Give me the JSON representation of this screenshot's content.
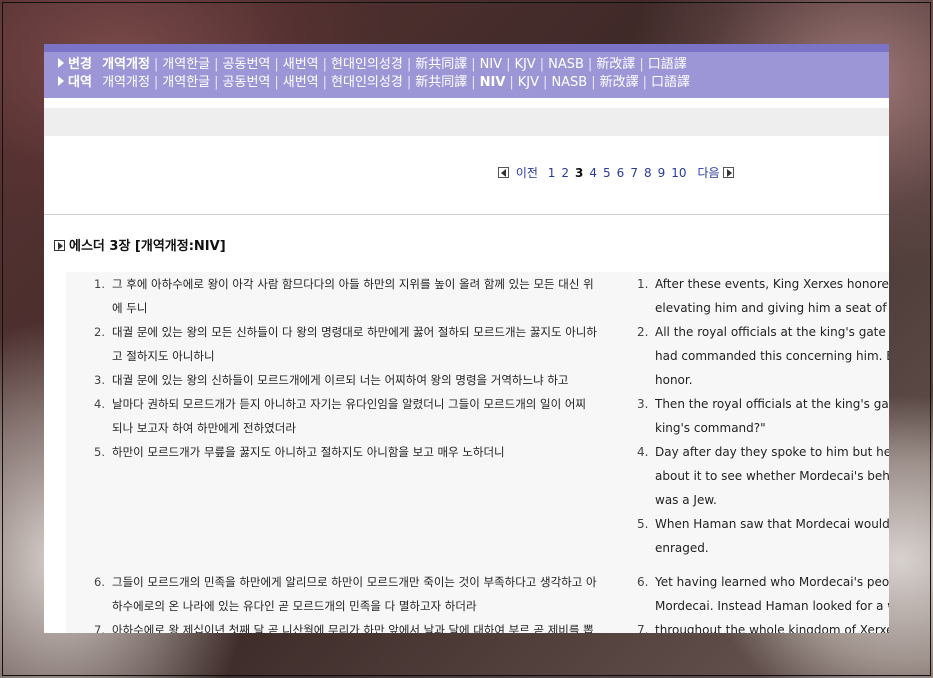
{
  "nav": {
    "row1": {
      "label": "변경",
      "items": [
        {
          "text": "개역개정",
          "bold": true
        },
        {
          "text": "개역한글"
        },
        {
          "text": "공동번역"
        },
        {
          "text": "새번역"
        },
        {
          "text": "현대인의성경"
        },
        {
          "text": "新共同譯"
        },
        {
          "text": "NIV"
        },
        {
          "text": "KJV"
        },
        {
          "text": "NASB"
        },
        {
          "text": "新改譯"
        },
        {
          "text": "口語譯"
        }
      ]
    },
    "row2": {
      "label": "대역",
      "items": [
        {
          "text": "개역개정"
        },
        {
          "text": "개역한글"
        },
        {
          "text": "공동번역"
        },
        {
          "text": "새번역"
        },
        {
          "text": "현대인의성경"
        },
        {
          "text": "新共同譯"
        },
        {
          "text": "NIV",
          "bold": true
        },
        {
          "text": "KJV"
        },
        {
          "text": "NASB"
        },
        {
          "text": "新改譯"
        },
        {
          "text": "口語譯"
        }
      ]
    }
  },
  "pager": {
    "prev": "이전",
    "next": "다음",
    "pages": [
      "1",
      "2",
      "3",
      "4",
      "5",
      "6",
      "7",
      "8",
      "9",
      "10"
    ],
    "current": "3"
  },
  "title": "에스더 3장 [개역개정:NIV]",
  "korean": [
    {
      "n": "1.",
      "lines": [
        "그 후에 아하수에로 왕이 아각 사람 함므다다의 아들 하만의 지위를 높이 올려 함께 있는 모든 대신 위",
        "에 두니"
      ]
    },
    {
      "n": "2.",
      "lines": [
        "대궐 문에 있는 왕의 모든 신하들이 다 왕의 명령대로 하만에게 꿇어 절하되 모르드개는 꿇지도 아니하",
        "고 절하지도 아니하니"
      ]
    },
    {
      "n": "3.",
      "lines": [
        "대궐 문에 있는 왕의 신하들이 모르드개에게 이르되 너는 어찌하여 왕의 명령을 거역하느냐 하고"
      ]
    },
    {
      "n": "4.",
      "lines": [
        "날마다 권하되 모르드개가 듣지 아니하고 자기는 유다인임을 알렸더니 그들이 모르드개의 일이 어찌",
        "되나 보고자 하여 하만에게 전하였더라"
      ]
    },
    {
      "n": "5.",
      "lines": [
        "하만이 모르드개가 무릎을 꿇지도 아니하고 절하지도 아니함을 보고 매우 노하더니"
      ]
    },
    {
      "n": "6.",
      "lines": [
        "그들이 모르드개의 민족을 하만에게 알리므로 하만이 모르드개만 죽이는 것이 부족하다고 생각하고 아",
        "하수에로의 온 나라에 있는 유다인 곧 모르드개의 민족을 다 멸하고자 하더라"
      ]
    },
    {
      "n": "7.",
      "lines": [
        "아하수에로 왕 제십이년 첫째 달 곧 니산월에 무리가 하만 앞에서 날과 달에 대하여 부르 곧 제비를 뽑"
      ]
    }
  ],
  "english": [
    {
      "n": "1.",
      "lines": [
        "After these events, King Xerxes honored Ha",
        "elevating him and giving him a seat of hono"
      ]
    },
    {
      "n": "2.",
      "lines": [
        "All the royal officials at the king's gate knel",
        "had commanded this concerning him. But M",
        "honor."
      ]
    },
    {
      "n": "3.",
      "lines": [
        "Then the royal officials at the king's gate as",
        "king's command?\""
      ]
    },
    {
      "n": "4.",
      "lines": [
        "Day after day they spoke to him but he refu",
        "about it to see whether Mordecai's behavio",
        "was a Jew."
      ]
    },
    {
      "n": "5.",
      "lines": [
        "When Haman saw that Mordecai would not",
        "enraged."
      ]
    },
    {
      "n": "6.",
      "lines": [
        "Yet having learned who Mordecai's people w",
        "Mordecai. Instead Haman looked for a way"
      ]
    },
    {
      "n": "7.",
      "lines": [
        "throughout the whole kingdom of Xerxes"
      ]
    }
  ],
  "colors": {
    "nav_bg": "#9d96d6",
    "nav_top": "#7b73c6",
    "link": "#2a2aa0"
  }
}
